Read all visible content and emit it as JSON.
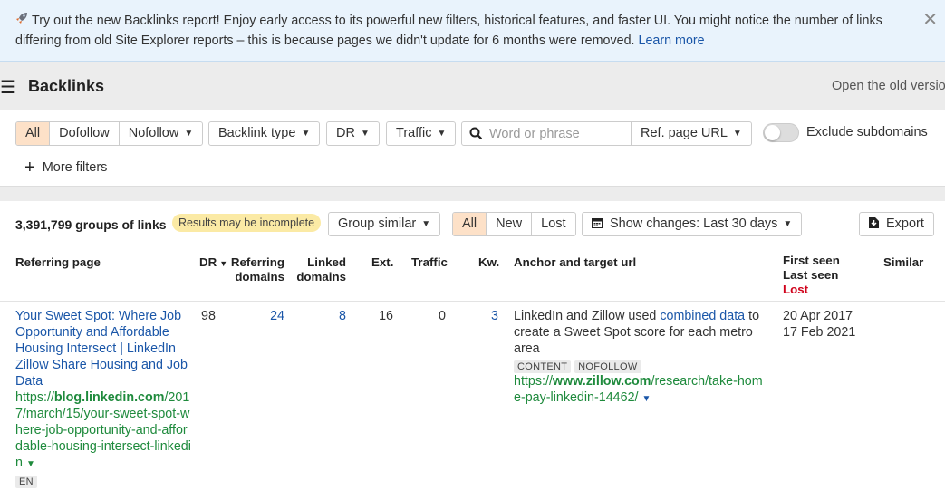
{
  "banner": {
    "icon": "rocket-icon",
    "text": "Try out the new Backlinks report! Enjoy early access to its powerful new filters, historical features, and faster UI. You might notice the number of links differing from old Site Explorer reports – this is because pages we didn't update for 6 months were removed.",
    "link": "Learn more",
    "close": "✕"
  },
  "header": {
    "menu_icon": "☰",
    "title": "Backlinks",
    "old_version": "Open the old version"
  },
  "filters": {
    "link_type": [
      "All",
      "Dofollow",
      "Nofollow"
    ],
    "active_link_type": "All",
    "backlink_type": "Backlink type",
    "dr": "DR",
    "traffic": "Traffic",
    "search_placeholder": "Word or phrase",
    "search_value": "",
    "scope": "Ref. page URL",
    "exclude_subdomains": "Exclude subdomains",
    "exclude_subdomains_on": false,
    "more_filters": "More filters"
  },
  "results": {
    "count": "3,391,799 groups of links",
    "incomplete_badge": "Results may be incomplete",
    "group_similar": "Group similar",
    "status_tabs": [
      "All",
      "New",
      "Lost"
    ],
    "active_status": "All",
    "show_changes": "Show changes: Last 30 days",
    "export": "Export"
  },
  "columns": {
    "referring_page": "Referring page",
    "dr": "DR",
    "referring_domains_1": "Referring",
    "referring_domains_2": "domains",
    "linked_domains_1": "Linked",
    "linked_domains_2": "domains",
    "ext": "Ext.",
    "traffic": "Traffic",
    "kw": "Kw.",
    "anchor": "Anchor and target url",
    "first_seen": "First seen",
    "last_seen": "Last seen",
    "lost": "Lost",
    "similar": "Similar"
  },
  "rows": [
    {
      "title": "Your Sweet Spot: Where Job Opportunity and Affordable Housing Intersect | LinkedIn Zillow Share Housing and Job Data",
      "url_prefix": "https://",
      "url_domain": "blog.linkedin.com",
      "url_path": "/2017/march/15/your-sweet-spot-where-job-opportunity-and-affordable-housing-intersect-linkedin",
      "lang": "EN",
      "dr": "98",
      "referring_domains": "24",
      "linked_domains": "8",
      "ext": "16",
      "traffic": "0",
      "kw": "3",
      "anchor_before": "LinkedIn and Zillow used ",
      "anchor_link": "combined data",
      "anchor_after": " to create a Sweet Spot score for each metro area",
      "tags": [
        "CONTENT",
        "NOFOLLOW"
      ],
      "target_prefix": "https://",
      "target_domain": "www.zillow.com",
      "target_path": "/research/take-home-pay-linkedin-14462/",
      "first_seen": "20 Apr 2017",
      "last_seen": "17 Feb 2021"
    }
  ]
}
